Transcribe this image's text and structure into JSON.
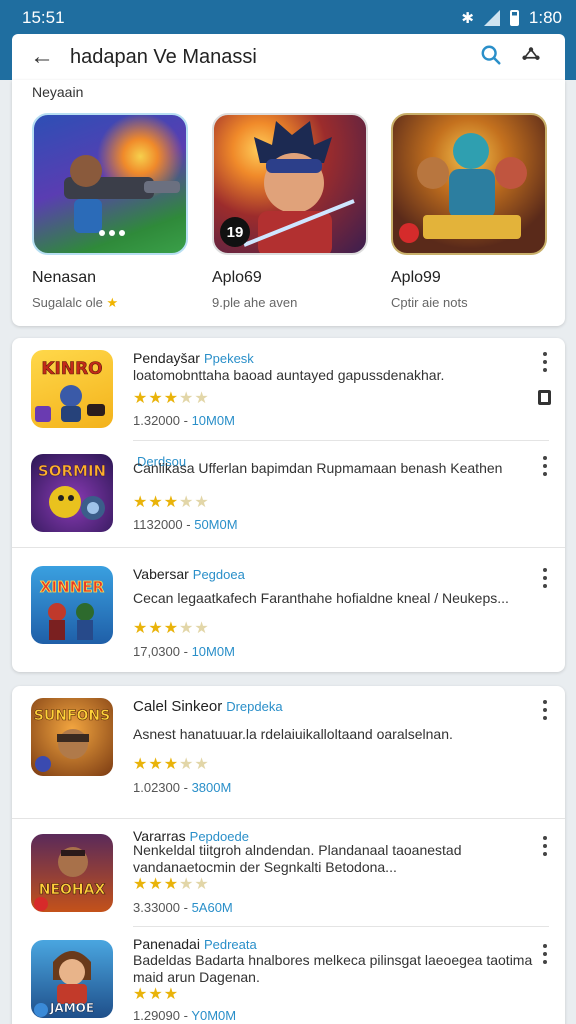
{
  "status_bar": {
    "time": "15:51",
    "clock_right": "1:80"
  },
  "top_bar": {
    "title": "hadapan Ve Manassi"
  },
  "featured": {
    "section_title": "Neyaain",
    "items": [
      {
        "name": "Nenasan",
        "sub": "Sugalalc ole",
        "badge": "",
        "icon": "blaster-hero-art"
      },
      {
        "name": "Aplo69",
        "sub": "9.ple ahe aven",
        "badge": "19",
        "icon": "warrior-boy-art"
      },
      {
        "name": "Aplo99",
        "sub": "Cptir aie nots",
        "badge": "",
        "icon": "team-heroes-art"
      }
    ]
  },
  "list1": [
    {
      "name": "Pendayšar",
      "tag": "Ppekesk",
      "desc": "loatomobnttaha baoad auntayed gapussdenakhar.",
      "rating": 3,
      "meta_count": "1.32000",
      "meta_dl": "10M0M",
      "icon_title": "KINRO"
    },
    {
      "name": "Canlikasa",
      "tag": "Derdsou",
      "desc": "Canlikasa Ufferlan bapimdan Rupmamaan benash Keathen",
      "rating": 3,
      "meta_count": "1132000",
      "meta_dl": "50M0M",
      "icon_title": "SORMIN"
    },
    {
      "name": "Vabersar",
      "tag": "Pegdoea",
      "desc": "Cecan legaatkafech Faranthahe hofialdne kneal / Neukeps...",
      "rating": 3,
      "meta_count": "17,0300",
      "meta_dl": "10M0M",
      "icon_title": "XINNER"
    }
  ],
  "list2": [
    {
      "name": "Calel Sinkeor",
      "tag": "Drepdeka",
      "desc": "Asnest hanatuuar.la rdelaiuikalloltaand oaralselnan.",
      "rating": 3,
      "meta_count": "1.02300",
      "meta_dl": "3800M",
      "icon_title": "SUNFONS"
    },
    {
      "name": "Vararras",
      "tag": "Pepdoede",
      "desc": "Nenkeldal tiitgroh alndendan. Plandanaal taoanestad vandanaetocmin der Segnkalti Betodona...",
      "rating": 3,
      "meta_count": "3.33000",
      "meta_dl": "5A60M",
      "icon_title": "NEOHAX"
    },
    {
      "name": "Panenadai",
      "tag": "Pedreata",
      "desc": "Badeldas Badarta hnalbores melkeca pilinsgat laeoegea taotima maid arun Dagenan.",
      "rating": 3,
      "meta_count": "1.29090",
      "meta_dl": "Y0M0M",
      "icon_title": "JAMOE"
    }
  ],
  "colors": {
    "header": "#1f6ea0",
    "accent": "#2a8fc9",
    "star": "#e9b30a"
  }
}
